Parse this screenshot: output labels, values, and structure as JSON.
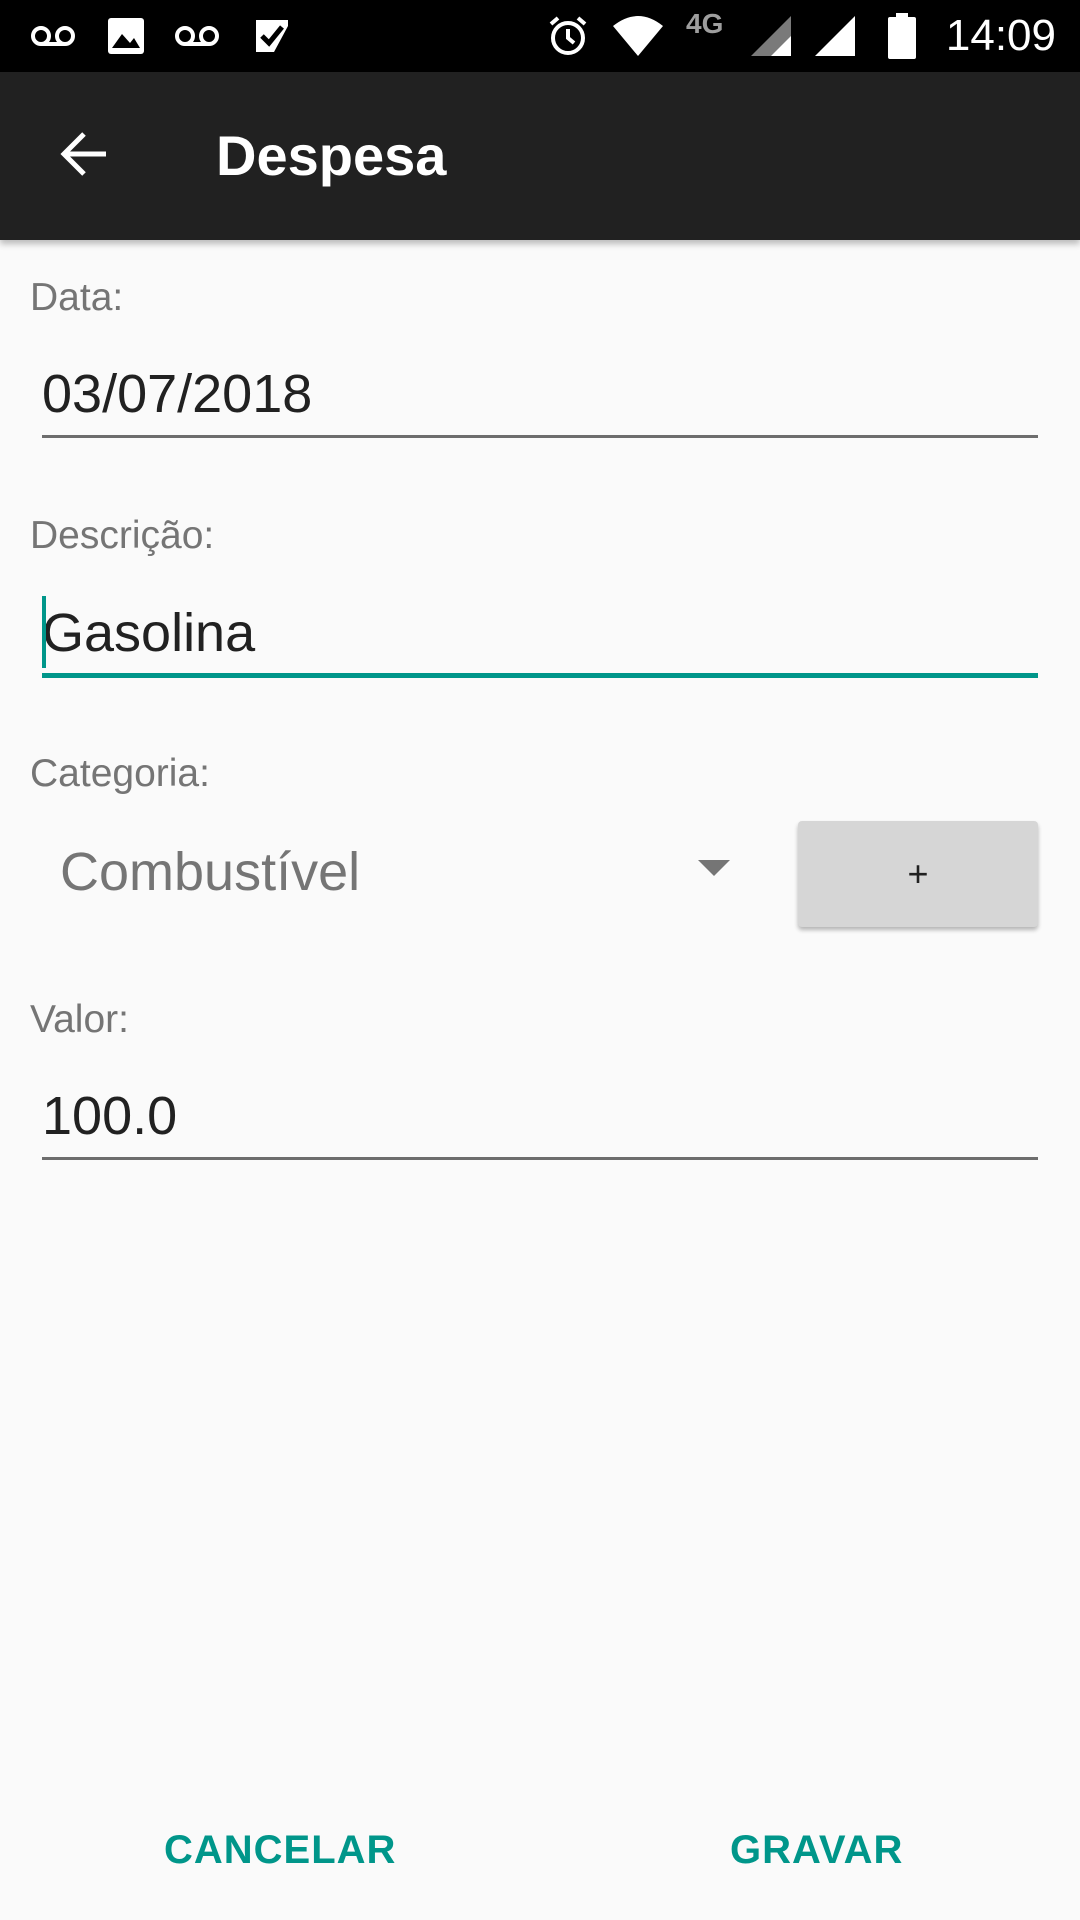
{
  "status_bar": {
    "time": "14:09",
    "network_label": "4G",
    "icons": [
      "voicemail-icon",
      "image-icon",
      "voicemail-icon",
      "task-check-icon",
      "alarm-icon",
      "wifi-icon",
      "signal-icon",
      "signal-icon",
      "battery-icon"
    ]
  },
  "app_bar": {
    "title": "Despesa",
    "back_icon": "arrow-back-icon"
  },
  "form": {
    "date_label": "Data:",
    "date_value": "03/07/2018",
    "description_label": "Descrição:",
    "description_value": "Gasolina",
    "category_label": "Categoria:",
    "category_selected": "Combustível",
    "add_category_label": "+",
    "value_label": "Valor:",
    "value_value": "100.0"
  },
  "actions": {
    "cancel_label": "CANCELAR",
    "save_label": "GRAVAR"
  },
  "colors": {
    "accent": "#00968a",
    "app_bar": "#212121",
    "background": "#fafafa"
  }
}
